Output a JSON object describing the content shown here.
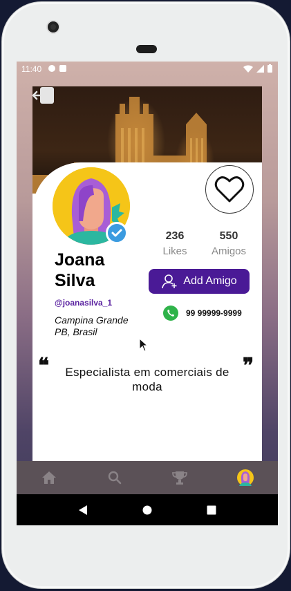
{
  "status_bar": {
    "time": "11:40"
  },
  "profile": {
    "name": "Joana Silva",
    "username": "@joanasilva_1",
    "location": "Campina Grande PB, Brasil",
    "bio": "Especialista em comerciais de moda",
    "phone": "99 99999-9999"
  },
  "stats": [
    {
      "value": "236",
      "label": "Likes"
    },
    {
      "value": "550",
      "label": "Amigos"
    }
  ],
  "actions": {
    "add_friend_label": "Add Amigo"
  },
  "quotes": {
    "open": "❝",
    "close": "❞"
  },
  "bottom_nav": [
    "home-icon",
    "search-icon",
    "trophy-icon",
    "profile-avatar"
  ],
  "colors": {
    "accent": "#4a1a96",
    "verified": "#3b9be0",
    "whatsapp": "#2fb34a",
    "nav_bg": "#5b5157"
  }
}
